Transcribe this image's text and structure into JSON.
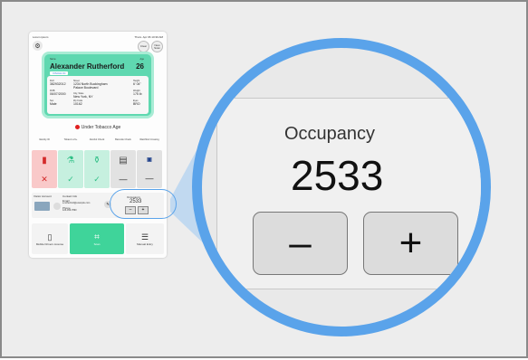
{
  "phone": {
    "status_left": "Lorem ipsum",
    "status_right": "Thurs. Apr 06 10:30 AM",
    "clear_label": "Clear",
    "new_scan_label": "New Scan"
  },
  "id_card": {
    "name_label": "Name",
    "name": "Alexander Rutherford",
    "age_label": "Age",
    "age": "26",
    "chip": "VISUAL ID",
    "id_label": "DL#",
    "id_value": "382932012",
    "street_label": "Street",
    "street_value": "1234 North Buckingham Palace Boulevard",
    "height_label": "Height",
    "height_value": "6' 04\"",
    "dob_label": "DOB",
    "dob_value": "06/07/2000",
    "city_label": "City, State",
    "city_value": "New York, NY",
    "weight_label": "Weight",
    "weight_value": "175 lb",
    "sex_label": "Sex",
    "sex_value": "Male",
    "zip_label": "Zip Code",
    "zip_value": "10162",
    "eye_label": "Eyes",
    "eye_value": "BRO"
  },
  "tobacco_status": "Under Tobacco Age",
  "checks": [
    {
      "head": "Identity ID",
      "mark": "✕"
    },
    {
      "head": "Tobacco 21+",
      "mark": "✓"
    },
    {
      "head": "Alcohol Check",
      "mark": "✓"
    },
    {
      "head": "Barcode Check",
      "mark": "—"
    },
    {
      "head": "Watchlist Crossing",
      "mark": "—"
    }
  ],
  "info_panel": {
    "left_label": "Visitor Account",
    "contact_label": "Contact Info",
    "email_label": "Email",
    "email_value": "a.rutherford@example.com",
    "phone_label": "Phone",
    "phone_value": "123-456-7890",
    "occupancy_label": "Occupancy",
    "occupancy_value": "2533",
    "minus": "–",
    "plus": "+"
  },
  "bottom_buttons": {
    "left": "Mobile Drivers License",
    "center": "Scan",
    "right": "Manual Entry"
  },
  "zoom": {
    "occupancy_label": "Occupancy",
    "occupancy_value": "2533",
    "minus_label": "–",
    "plus_label": "+"
  },
  "colors": {
    "accent_blue": "#5aa3ea",
    "card_green": "#5fd8b0",
    "check_green": "#c6f0df",
    "fail_red": "#f9c9c9",
    "scan_green": "#3fd49a"
  }
}
